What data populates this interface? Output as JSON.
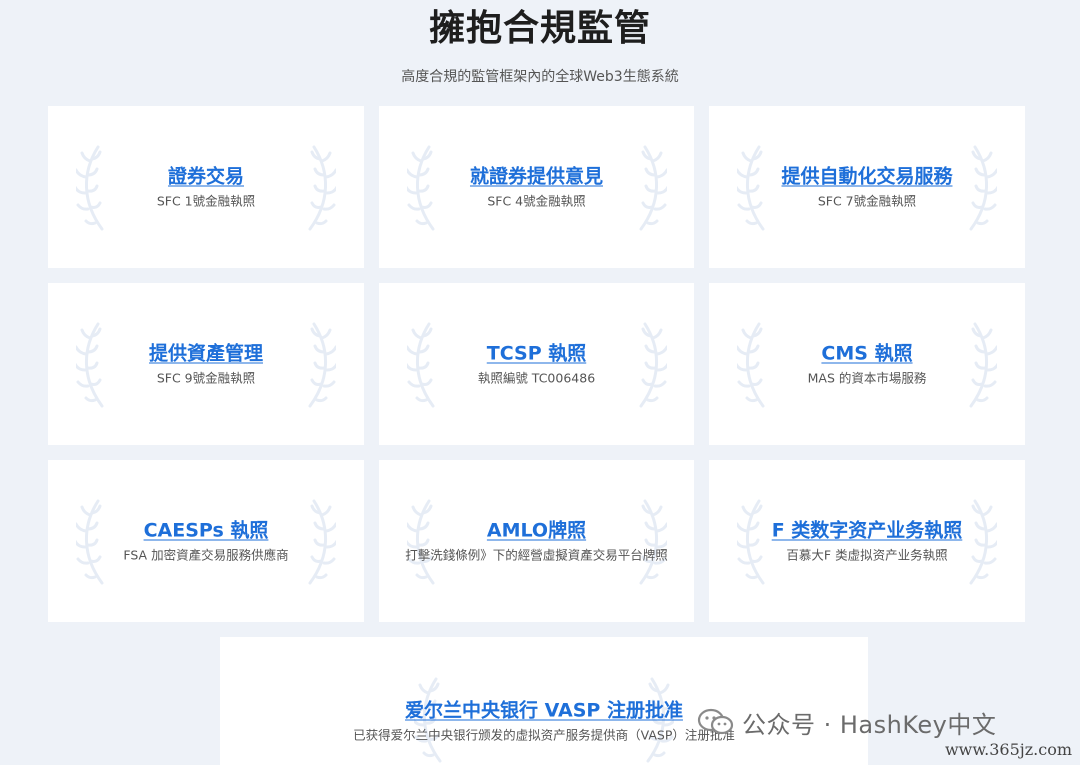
{
  "header": {
    "title": "擁抱合規監管",
    "subtitle": "高度合規的監管框架內的全球Web3生態系統"
  },
  "cards": [
    {
      "title": "證券交易",
      "desc": "SFC 1號金融執照"
    },
    {
      "title": "就證券提供意見",
      "desc": "SFC 4號金融執照"
    },
    {
      "title": "提供自動化交易服務",
      "desc": "SFC 7號金融執照"
    },
    {
      "title": "提供資產管理",
      "desc": "SFC 9號金融執照"
    },
    {
      "title": "TCSP 執照",
      "desc": "執照編號 TC006486"
    },
    {
      "title": "CMS 執照",
      "desc": "MAS 的資本市場服務"
    },
    {
      "title": "CAESPs 執照",
      "desc": "FSA 加密資產交易服務供應商"
    },
    {
      "title": "AMLO牌照",
      "desc": "打擊洗錢條例》下的經營虛擬資產交易平台牌照"
    },
    {
      "title": "F 类数字资产业务執照",
      "desc": "百慕大F 类虚拟资产业务執照"
    },
    {
      "title": "爱尔兰中央银行 VASP 注册批准",
      "desc": "已获得爱尔兰中央银行颁发的虚拟资产服务提供商（VASP）注册批准"
    }
  ],
  "watermark": {
    "text": "公众号 · HashKey中文",
    "url": "www.365jz.com",
    "icon": "wechat-icon"
  },
  "colors": {
    "accent": "#1e6fd9",
    "background": "#eef2f8",
    "card": "#ffffff"
  }
}
